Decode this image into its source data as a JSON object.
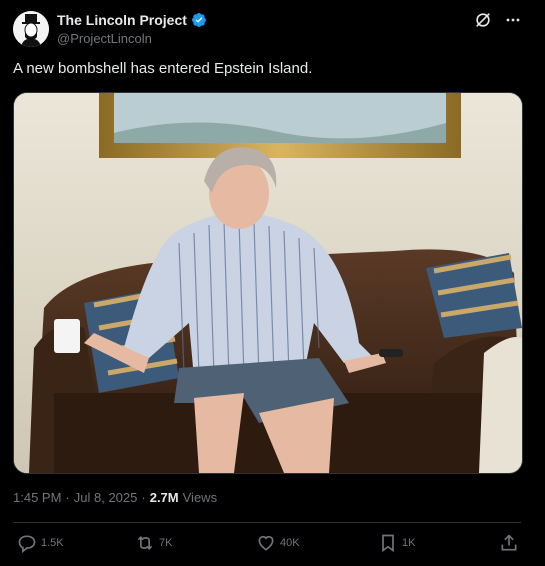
{
  "author": {
    "name": "The Lincoln Project",
    "handle": "@ProjectLincoln"
  },
  "tweet": {
    "text": "A new bombshell has entered Epstein Island."
  },
  "meta": {
    "time": "1:45 PM",
    "separator1": "·",
    "date": "Jul 8, 2025",
    "separator2": "·",
    "views_count": "2.7M",
    "views_label": "Views"
  },
  "actions": {
    "replies": "1.5K",
    "reposts": "7K",
    "likes": "40K",
    "bookmarks": "1K"
  },
  "colors": {
    "background": "#000000",
    "text": "#e7e9ea",
    "secondary": "#71767b",
    "verified": "#1d9bf0",
    "border": "#2f3336"
  },
  "icons": [
    "verified-badge-icon",
    "grok-icon",
    "more-icon",
    "reply-icon",
    "repost-icon",
    "like-icon",
    "bookmark-icon",
    "share-icon"
  ]
}
